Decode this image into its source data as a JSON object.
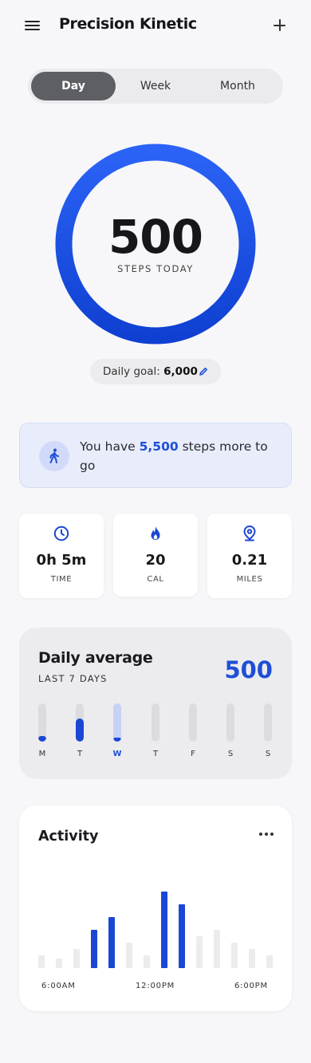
{
  "header": {
    "title": "Precision Kinetic",
    "menu_icon": "menu-icon",
    "add_icon": "plus-icon"
  },
  "segments": [
    {
      "label": "Day",
      "active": true
    },
    {
      "label": "Week",
      "active": false
    },
    {
      "label": "Month",
      "active": false
    }
  ],
  "steps": {
    "value": "500",
    "label": "STEPS TODAY"
  },
  "goal": {
    "prefix": "Daily goal:",
    "value": "6,000",
    "edit_icon": "pencil-icon"
  },
  "info": {
    "icon": "walking-person-icon",
    "pre": "You have ",
    "highlight": "5,500",
    "post": " steps more to go"
  },
  "stats": [
    {
      "icon": "clock-icon",
      "value": "0h 5m",
      "label": "TIME"
    },
    {
      "icon": "flame-icon",
      "value": "20",
      "label": "CAL"
    },
    {
      "icon": "map-pin-icon",
      "value": "0.21",
      "label": "MILES"
    }
  ],
  "daily_average": {
    "title": "Daily average",
    "subtitle": "LAST 7 DAYS",
    "value": "500",
    "days": [
      {
        "label": "M",
        "level": 0.15,
        "style": "dark"
      },
      {
        "label": "T",
        "level": 0.6,
        "style": "dark"
      },
      {
        "label": "W",
        "level": 0.1,
        "style": "current",
        "track_level": 1.0
      },
      {
        "label": "T",
        "level": 0,
        "style": "none"
      },
      {
        "label": "F",
        "level": 0,
        "style": "none"
      },
      {
        "label": "S",
        "level": 0,
        "style": "none"
      },
      {
        "label": "S",
        "level": 0,
        "style": "none"
      }
    ]
  },
  "activity": {
    "title": "Activity",
    "more_icon": "more-horizontal-icon",
    "ticks": [
      "6:00AM",
      "12:00PM",
      "6:00PM"
    ],
    "bars": [
      {
        "v": 16,
        "hl": false
      },
      {
        "v": 12,
        "hl": false
      },
      {
        "v": 24,
        "hl": false
      },
      {
        "v": 48,
        "hl": true
      },
      {
        "v": 64,
        "hl": true
      },
      {
        "v": 32,
        "hl": false
      },
      {
        "v": 16,
        "hl": false
      },
      {
        "v": 96,
        "hl": true
      },
      {
        "v": 80,
        "hl": true
      },
      {
        "v": 40,
        "hl": false
      },
      {
        "v": 48,
        "hl": false
      },
      {
        "v": 32,
        "hl": false
      },
      {
        "v": 24,
        "hl": false
      },
      {
        "v": 16,
        "hl": false
      }
    ],
    "colors": {
      "highlight": "#1a47d4",
      "base": "#ececef"
    }
  },
  "colors": {
    "accent": "#1f4fd6",
    "ring_start": "#2a62f5",
    "ring_end": "#0f3fd0"
  }
}
